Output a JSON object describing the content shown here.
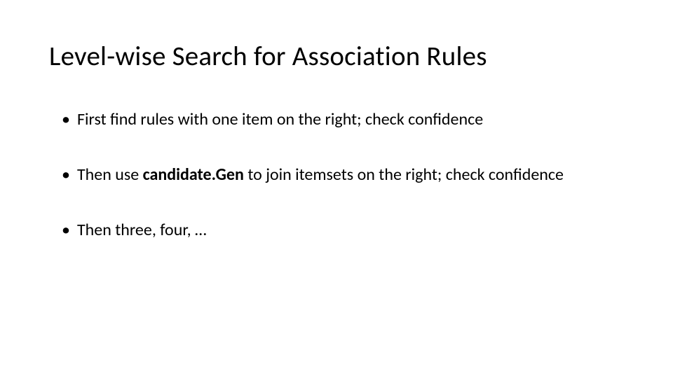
{
  "slide": {
    "title": "Level-wise Search for Association Rules",
    "bullets": [
      {
        "marker": "•",
        "segments": [
          {
            "text": "First find rules with one item on the right; check confidence",
            "bold": false
          }
        ]
      },
      {
        "marker": "•",
        "segments": [
          {
            "text": "Then use ",
            "bold": false
          },
          {
            "text": "candidate.Gen",
            "bold": true
          },
          {
            "text": " to join itemsets on the right; check confidence",
            "bold": false
          }
        ]
      },
      {
        "marker": "•",
        "segments": [
          {
            "text": "Then three, four, …",
            "bold": false
          }
        ]
      }
    ]
  }
}
